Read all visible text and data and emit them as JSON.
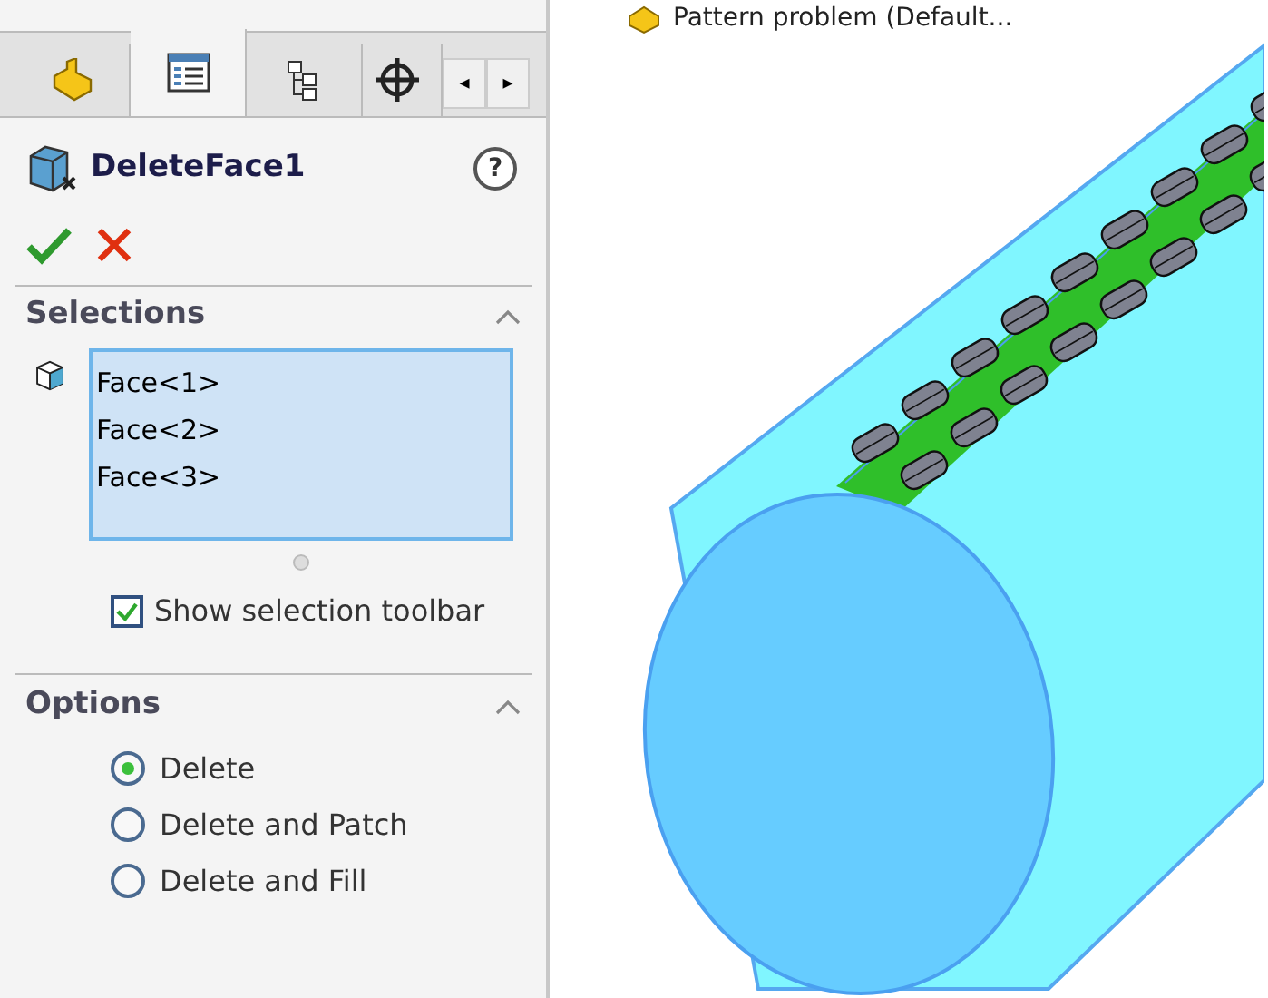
{
  "tabs": [
    {
      "kind": "part",
      "selected": false
    },
    {
      "kind": "property",
      "selected": true
    },
    {
      "kind": "config",
      "selected": false
    },
    {
      "kind": "origin",
      "selected": false
    }
  ],
  "tab_scroll": [
    "◂",
    "▸"
  ],
  "feature": {
    "title": "DeleteFace1",
    "help": "?"
  },
  "selections": {
    "heading": "Selections",
    "expanded": true,
    "items": [
      "Face<1>",
      "Face<2>",
      "Face<3>"
    ],
    "show_toolbar": {
      "label": "Show selection toolbar",
      "checked": true
    }
  },
  "options": {
    "heading": "Options",
    "expanded": true,
    "choices": [
      {
        "label": "Delete",
        "selected": true
      },
      {
        "label": "Delete and Patch",
        "selected": false
      },
      {
        "label": "Delete and Fill",
        "selected": false
      }
    ]
  },
  "tree_label": "Pattern problem  (Default..."
}
